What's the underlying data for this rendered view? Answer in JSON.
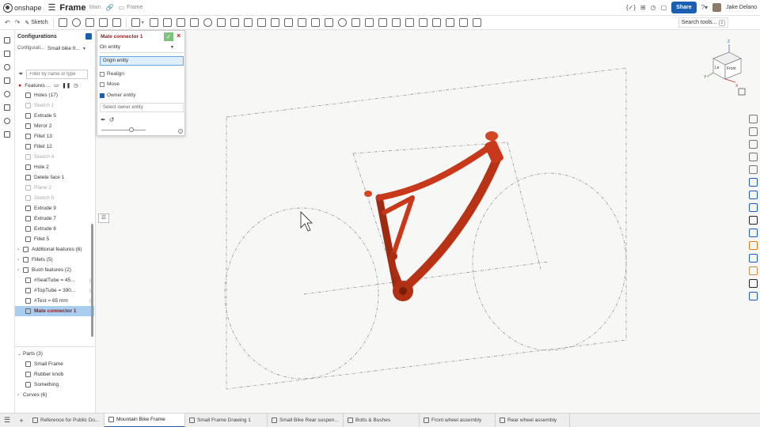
{
  "topbar": {
    "logo_text": "onshape",
    "doc_title": "Frame",
    "branch": "Main",
    "breadcrumb": "Frame",
    "share_label": "Share",
    "user_name": "Jake Delano"
  },
  "toolbar": {
    "sketch_label": "Sketch",
    "search_label": "Search tools...",
    "search_shortcut": "c"
  },
  "configurations": {
    "title": "Configurations",
    "label": "Configurati...",
    "value": "Small bike fr..."
  },
  "filter": {
    "placeholder": "Filter by name or type"
  },
  "features": {
    "header": "Features ...",
    "items": [
      {
        "label": "Holes (17)",
        "state": "normal"
      },
      {
        "label": "Sketch 1",
        "state": "faded"
      },
      {
        "label": "Extrude 5",
        "state": "normal"
      },
      {
        "label": "Mirror 2",
        "state": "normal"
      },
      {
        "label": "Fillet 13",
        "state": "normal"
      },
      {
        "label": "Fillet 12",
        "state": "normal"
      },
      {
        "label": "Sketch 4",
        "state": "faded"
      },
      {
        "label": "Hole 2",
        "state": "normal"
      },
      {
        "label": "Delete face 1",
        "state": "normal"
      },
      {
        "label": "Plane 2",
        "state": "faded"
      },
      {
        "label": "Sketch 5",
        "state": "faded"
      },
      {
        "label": "Extrude 9",
        "state": "normal"
      },
      {
        "label": "Extrude 7",
        "state": "normal"
      },
      {
        "label": "Extrude 8",
        "state": "normal"
      },
      {
        "label": "Fillet 5",
        "state": "normal"
      },
      {
        "label": "Additional features (6)",
        "state": "folder"
      },
      {
        "label": "Fillets (5)",
        "state": "folder"
      },
      {
        "label": "Bush features (2)",
        "state": "folder"
      },
      {
        "label": "#SeatTube = 45...",
        "state": "var"
      },
      {
        "label": "#TopTube = 390...",
        "state": "var"
      },
      {
        "label": "#Test = 65 mm",
        "state": "var"
      },
      {
        "label": "Mate connector 1",
        "state": "selected"
      }
    ]
  },
  "parts": {
    "header": "Parts (3)",
    "items": [
      "Small Frame",
      "Rubber knob",
      "Something"
    ],
    "curves": "Curves (6)"
  },
  "mate_dialog": {
    "title": "Mate connector 1",
    "mode": "On entity",
    "origin_label": "Origin entity",
    "realign_label": "Realign",
    "move_label": "Move",
    "owner_label": "Owner entity",
    "owner_placeholder": "Select owner entity"
  },
  "view_cube": {
    "left_face": "Le",
    "front_face": "Front",
    "axis_x": "X",
    "axis_y": "Y",
    "axis_z": "Z"
  },
  "tabs": [
    {
      "label": "Reference for Public Do...",
      "active": false
    },
    {
      "label": "Mountain Bike Frame",
      "active": true
    },
    {
      "label": "Small Frame Drawing 1",
      "active": false
    },
    {
      "label": "Small Bike Rear suspen...",
      "active": false
    },
    {
      "label": "Bolts & Bushes",
      "active": false
    },
    {
      "label": "Front wheel assembly",
      "active": false
    },
    {
      "label": "Rear wheel assembly",
      "active": false
    }
  ],
  "colors": {
    "frame": "#c8381a",
    "accent": "#1a5fb4",
    "error": "#c62828"
  }
}
